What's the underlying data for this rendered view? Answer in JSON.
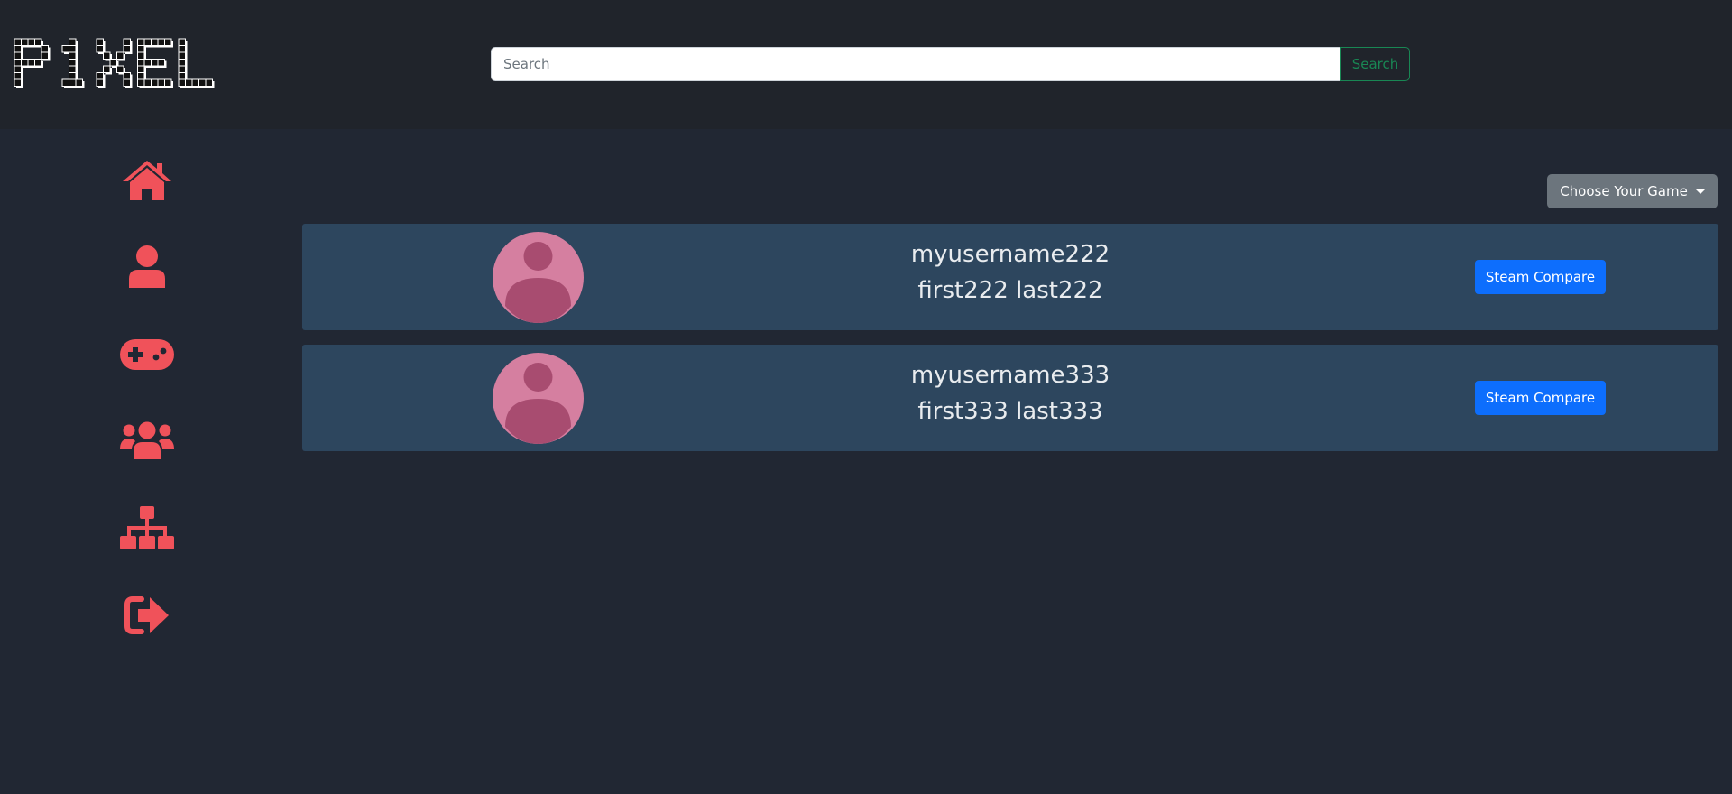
{
  "header": {
    "logo_text": "P1XEL",
    "search": {
      "placeholder": "Search",
      "value": ""
    },
    "search_button_label": "Search"
  },
  "sidebar": {
    "items": [
      {
        "icon": "home-icon"
      },
      {
        "icon": "user-icon"
      },
      {
        "icon": "gamepad-icon"
      },
      {
        "icon": "users-icon"
      },
      {
        "icon": "sitemap-icon"
      },
      {
        "icon": "sign-out-icon"
      }
    ],
    "icon_color": "#f0525a"
  },
  "main": {
    "game_dropdown_label": "Choose Your Game",
    "users": [
      {
        "username": "myusername222",
        "full_name": "first222 last222",
        "action_label": "Steam Compare"
      },
      {
        "username": "myusername333",
        "full_name": "first333 last333",
        "action_label": "Steam Compare"
      }
    ]
  },
  "colors": {
    "page_bg": "#212733",
    "header_bg": "#20242b",
    "card_bg": "#2d465e",
    "accent_red": "#f0525a",
    "primary_blue": "#0d6efd",
    "success_green": "#198754",
    "avatar_bg": "#d57fa0",
    "avatar_figure": "#a84c70"
  }
}
